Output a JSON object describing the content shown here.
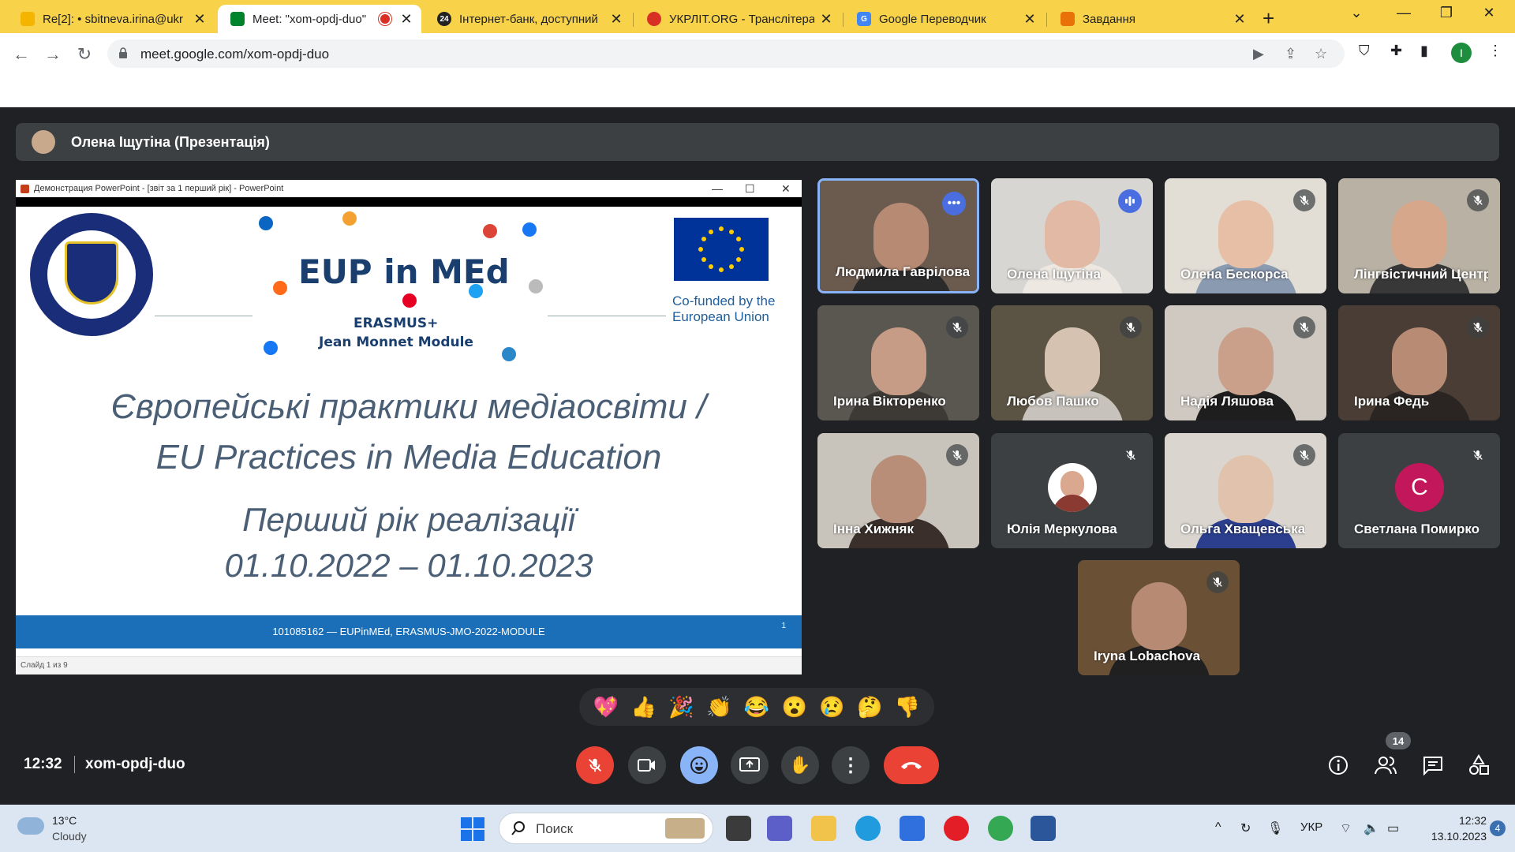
{
  "browser": {
    "tabs": [
      {
        "title": "Re[2]: • sbitneva.irina@ukr",
        "favicon_color": "#f4b400"
      },
      {
        "title": "Meet: \"xom-opdj-duo\"",
        "favicon_color": "#00832d",
        "active": true
      },
      {
        "title": "Інтернет-банк, доступний",
        "favicon_color": "#222222"
      },
      {
        "title": "УКРЛІТ.ORG - Транслітера",
        "favicon_color": "#d93025"
      },
      {
        "title": "Google Переводчик",
        "favicon_color": "#4285f4"
      },
      {
        "title": "Завдання",
        "favicon_color": "#e8710a"
      }
    ],
    "url": "meet.google.com/xom-opdj-duo",
    "profile_initial": "I"
  },
  "meet": {
    "presenter_label": "Олена Іщутіна (Презентація)",
    "meeting_time": "12:32",
    "meeting_code": "xom-opdj-duo",
    "people_count": "14",
    "participants": [
      {
        "name": "Людмила Гаврілова",
        "state": "more",
        "skin": "#b78a73",
        "bg": "#6b5a4e",
        "shirt": "#2b2b2b"
      },
      {
        "name": "Олена Іщутіна",
        "state": "speaking",
        "skin": "#e2b9a5",
        "bg": "#d8d6d2",
        "shirt": "#ede8e2"
      },
      {
        "name": "Олена Бескорса",
        "state": "muted",
        "skin": "#e6bfa6",
        "bg": "#e2ddd5",
        "shirt": "#8a9ab0"
      },
      {
        "name": "Лінгвістичний Центр",
        "state": "muted",
        "skin": "#d7a78c",
        "bg": "#b8b1a4",
        "shirt": "#383838"
      },
      {
        "name": "Ірина Вікторенко",
        "state": "muted",
        "skin": "#c79c86",
        "bg": "#5a5650",
        "shirt": "#3d3a36"
      },
      {
        "name": "Любов Пашко",
        "state": "muted",
        "skin": "#d6c2b0",
        "bg": "#5b5344",
        "shirt": "#c7c2bb"
      },
      {
        "name": "Надія Ляшова",
        "state": "muted",
        "skin": "#caa08a",
        "bg": "#cfc9c2",
        "shirt": "#1e1e1e"
      },
      {
        "name": "Ірина Федь",
        "state": "muted",
        "skin": "#b88c74",
        "bg": "#4a3d35",
        "shirt": "#2a2522"
      },
      {
        "name": "Інна Хижняк",
        "state": "muted",
        "skin": "#b98e78",
        "bg": "#c9c4bb",
        "shirt": "#3a2f2a"
      },
      {
        "name": "Юлія Меркулова",
        "state": "muted",
        "avatar": "photo"
      },
      {
        "name": "Ольга Хващевська",
        "state": "muted",
        "skin": "#e1c3ad",
        "bg": "#dad6cf",
        "shirt": "#2b3f8e"
      },
      {
        "name": "Светлана Помирко",
        "state": "muted",
        "avatar": "letter",
        "letter": "C"
      },
      {
        "name": "Iryna Lobachova",
        "state": "muted",
        "skin": "#b78b73",
        "bg": "#6a5136",
        "shirt": "#202020"
      }
    ],
    "reactions": [
      "💖",
      "👍",
      "🎉",
      "👏",
      "😂",
      "😮",
      "😢",
      "🤔",
      "👎"
    ]
  },
  "slide": {
    "window_title": "Демонстрация PowerPoint - [звіт за 1 перший рік] - PowerPoint",
    "logo_title": "EUP in MEd",
    "logo_sub1": "ERASMUS+",
    "logo_sub2": "Jean Monnet Module",
    "cofunded_1": "Co-funded by the",
    "cofunded_2": "European Union",
    "heading_line1": "Європейські практики медіаосвіти /",
    "heading_line2": "EU Practices in Media Education",
    "sub_line1": "Перший рік реалізації",
    "sub_line2": "01.10.2022 – 01.10.2023",
    "footer": "101085162 — EUPinMEd, ERASMUS-JMO-2022-MODULE",
    "slide_number": "1",
    "status": "Слайд 1 из 9"
  },
  "taskbar": {
    "temperature": "13°C",
    "weather": "Cloudy",
    "search_placeholder": "Поиск",
    "language": "УКР",
    "time": "12:32",
    "date": "13.10.2023",
    "notifications": "4"
  }
}
